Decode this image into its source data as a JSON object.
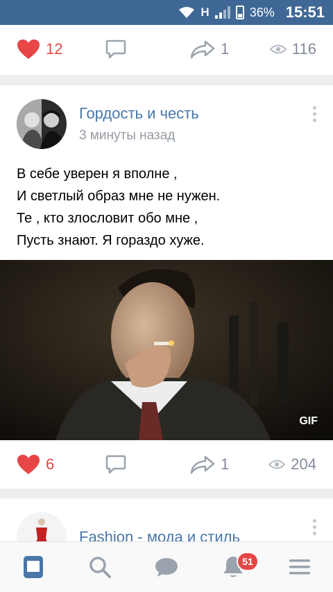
{
  "status_bar": {
    "network": "H",
    "battery": "36%",
    "time": "15:51"
  },
  "posts": [
    {
      "likes": "12",
      "shares": "1",
      "views": "116"
    },
    {
      "group": "Гордость и честь",
      "time": "3 минуты назад",
      "text_lines": [
        "В себе уверен я вполне ,",
        "И светлый образ мне не нужен.",
        "Те , кто злословит обо мне ,",
        "Пусть знают. Я гораздо хуже."
      ],
      "media_label": "GIF",
      "likes": "6",
      "shares": "1",
      "views": "204"
    },
    {
      "group": "Fashion - мода и стиль"
    }
  ],
  "tabbar": {
    "items": [
      "news-icon",
      "search-icon",
      "messages-icon",
      "notifications-icon",
      "menu-icon"
    ],
    "notifications_badge": "51",
    "accent": "#4a76a8"
  },
  "colors": {
    "status_bar": "#3f6896",
    "like": "#e64646",
    "link": "#4a76a8",
    "muted": "#828a99"
  }
}
